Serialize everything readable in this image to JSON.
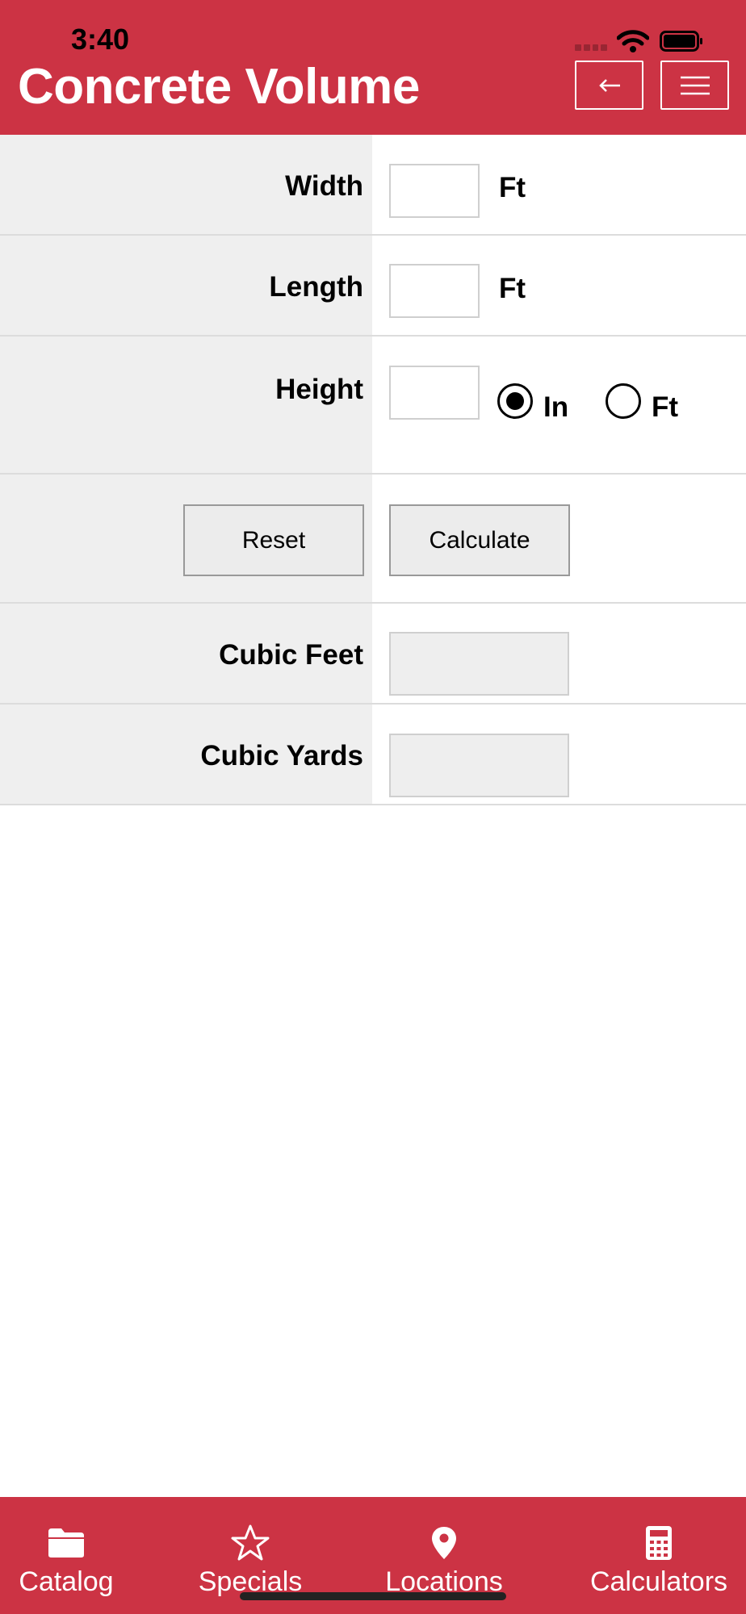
{
  "status_bar": {
    "time": "3:40"
  },
  "header": {
    "title": "Concrete Volume",
    "back_icon": "arrow-left-icon",
    "menu_icon": "hamburger-menu-icon",
    "background_color": "#cc3344"
  },
  "form": {
    "width": {
      "label": "Width",
      "value": "",
      "unit": "Ft"
    },
    "length": {
      "label": "Length",
      "value": "",
      "unit": "Ft"
    },
    "height": {
      "label": "Height",
      "value": "",
      "unit_options": [
        "In",
        "Ft"
      ],
      "selected_unit": "In"
    },
    "reset_label": "Reset",
    "calculate_label": "Calculate",
    "cubic_feet": {
      "label": "Cubic Feet",
      "value": ""
    },
    "cubic_yards": {
      "label": "Cubic Yards",
      "value": ""
    }
  },
  "tab_bar": {
    "items": [
      {
        "label": "Catalog",
        "icon": "folder-icon"
      },
      {
        "label": "Specials",
        "icon": "star-icon"
      },
      {
        "label": "Locations",
        "icon": "map-pin-icon"
      },
      {
        "label": "Calculators",
        "icon": "calculator-icon"
      }
    ]
  }
}
